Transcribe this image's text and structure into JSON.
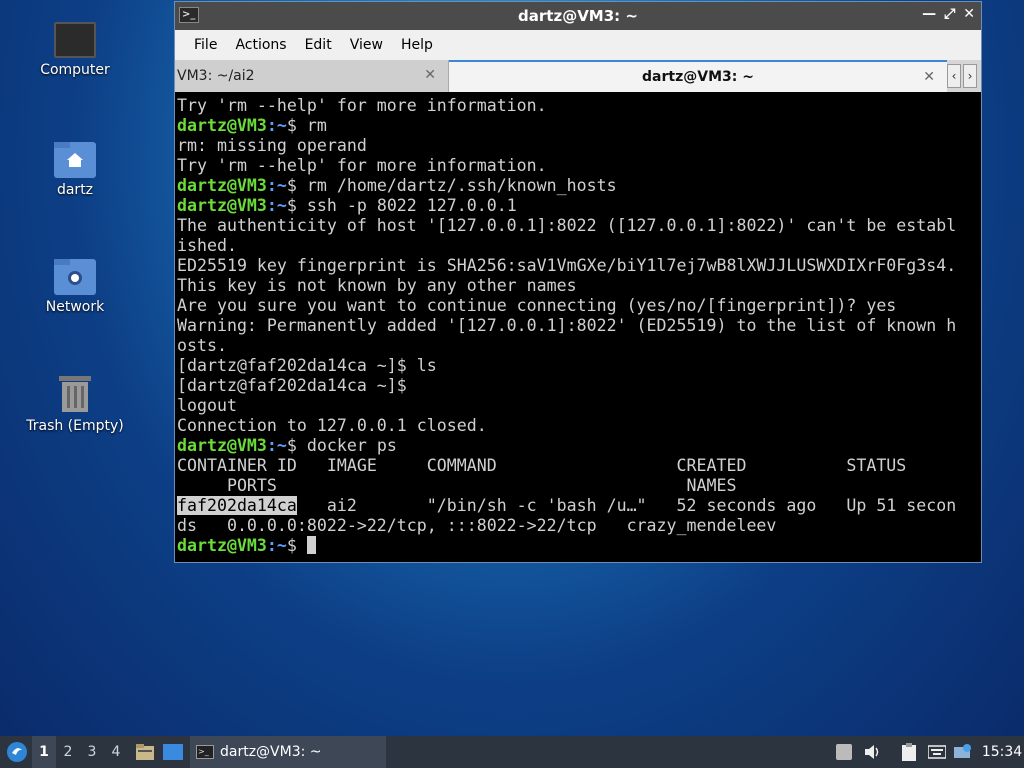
{
  "desktop": {
    "icons": [
      {
        "label": "Computer"
      },
      {
        "label": "dartz"
      },
      {
        "label": "Network"
      },
      {
        "label": "Trash (Empty)"
      }
    ]
  },
  "window": {
    "title": "dartz@VM3: ~",
    "menu": {
      "file": "File",
      "actions": "Actions",
      "edit": "Edit",
      "view": "View",
      "help": "Help"
    },
    "tabs": [
      {
        "label": "VM3: ~/ai2",
        "active": false
      },
      {
        "label": "dartz@VM3: ~",
        "active": true
      }
    ]
  },
  "terminal": {
    "prompt_user": "dartz@VM3",
    "prompt_path": ":~",
    "prompt_symbol": "$ ",
    "lines": [
      "Try 'rm --help' for more information.",
      "rm",
      "rm: missing operand",
      "Try 'rm --help' for more information.",
      "rm /home/dartz/.ssh/known_hosts",
      "ssh -p 8022 127.0.0.1",
      "The authenticity of host '[127.0.0.1]:8022 ([127.0.0.1]:8022)' can't be establ",
      "ished.",
      "ED25519 key fingerprint is SHA256:saV1VmGXe/biY1l7ej7wB8lXWJJLUSWXDIXrF0Fg3s4.",
      "This key is not known by any other names",
      "Are you sure you want to continue connecting (yes/no/[fingerprint])? yes",
      "Warning: Permanently added '[127.0.0.1]:8022' (ED25519) to the list of known h",
      "osts.",
      "[dartz@faf202da14ca ~]$ ls",
      "[dartz@faf202da14ca ~]$",
      "logout",
      "Connection to 127.0.0.1 closed.",
      "docker ps",
      "CONTAINER ID   IMAGE     COMMAND                  CREATED          STATUS",
      "     PORTS                                         NAMES",
      "faf202da14ca",
      "   ai2       \"/bin/sh -c 'bash /u…\"   52 seconds ago   Up 51 secon",
      "ds   0.0.0.0:8022->22/tcp, :::8022->22/tcp   crazy_mendeleev"
    ]
  },
  "taskbar": {
    "workspaces": [
      "1",
      "2",
      "3",
      "4"
    ],
    "task_label": "dartz@VM3: ~",
    "clock": "15:34"
  }
}
